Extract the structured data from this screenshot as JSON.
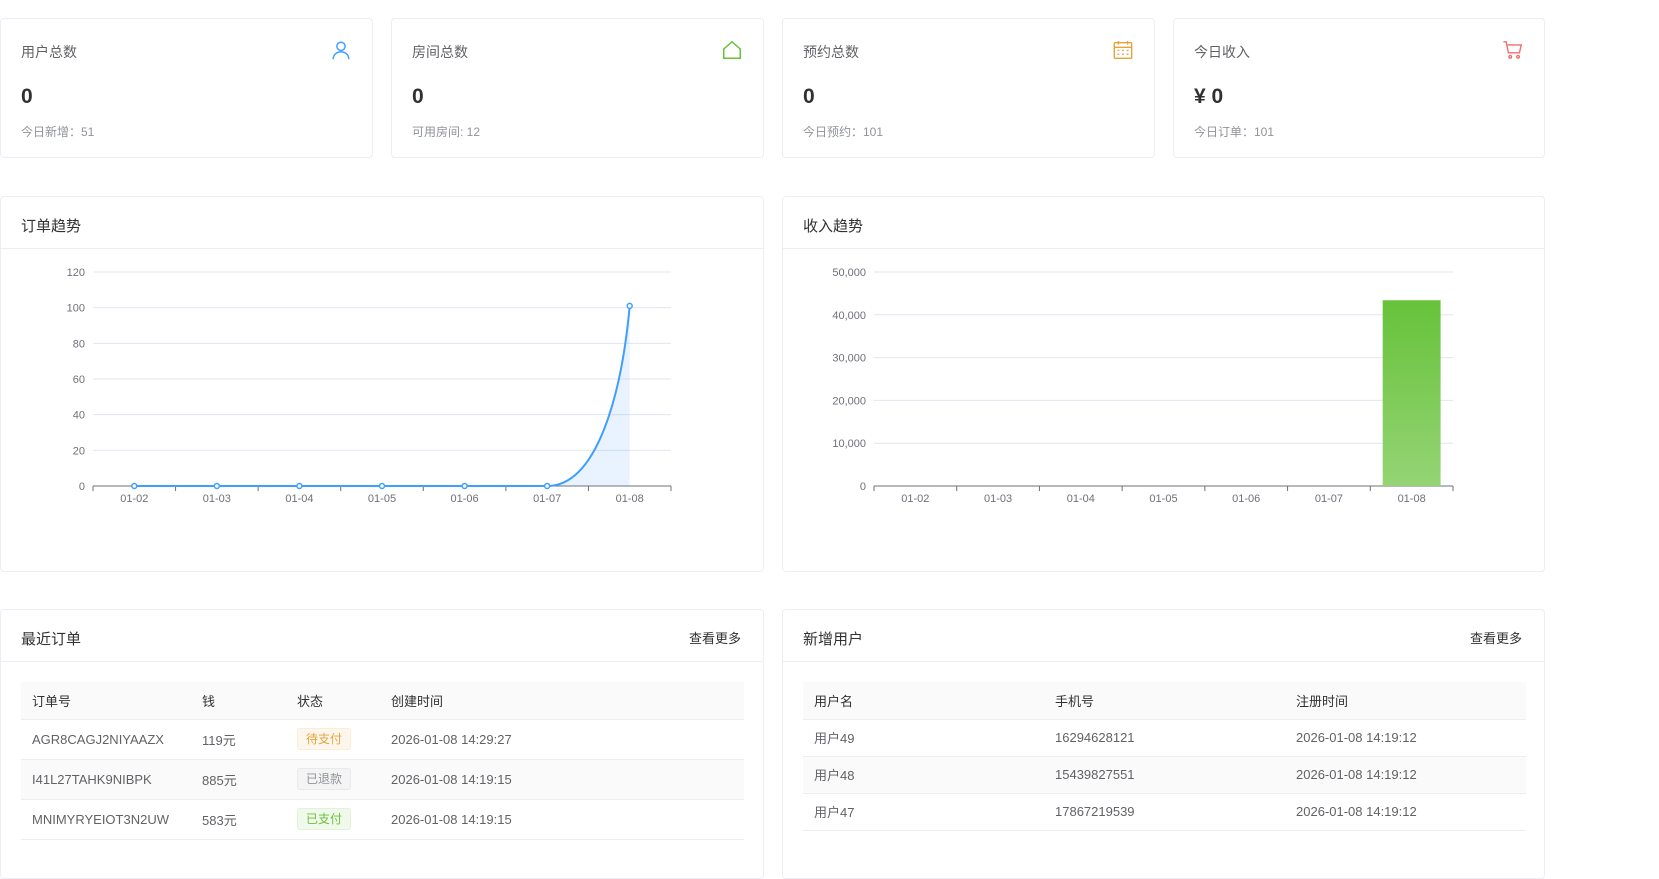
{
  "stats": [
    {
      "title": "用户总数",
      "value": "0",
      "sub": "今日新增：51",
      "icon": "user-icon",
      "color": "#409eff"
    },
    {
      "title": "房间总数",
      "value": "0",
      "sub": "可用房间: 12",
      "icon": "home-icon",
      "color": "#67c23a"
    },
    {
      "title": "预约总数",
      "value": "0",
      "sub": "今日预约：101",
      "icon": "calendar-icon",
      "color": "#e6a23c"
    },
    {
      "title": "今日收入",
      "value": "¥ 0",
      "sub": "今日订单：101",
      "icon": "cart-icon",
      "color": "#f56c6c"
    }
  ],
  "order_trend": {
    "title": "订单趋势"
  },
  "income_trend": {
    "title": "收入趋势"
  },
  "chart_data": [
    {
      "type": "line",
      "title": "订单趋势",
      "categories": [
        "01-02",
        "01-03",
        "01-04",
        "01-05",
        "01-06",
        "01-07",
        "01-08"
      ],
      "values": [
        0,
        0,
        0,
        0,
        0,
        0,
        101
      ],
      "ylim": [
        0,
        120
      ],
      "yticks": [
        0,
        20,
        40,
        60,
        80,
        100,
        120
      ],
      "color": "#409eff",
      "grid": true
    },
    {
      "type": "bar",
      "title": "收入趋势",
      "categories": [
        "01-02",
        "01-03",
        "01-04",
        "01-05",
        "01-06",
        "01-07",
        "01-08"
      ],
      "values": [
        0,
        0,
        0,
        0,
        0,
        0,
        43400
      ],
      "ylim": [
        0,
        50000
      ],
      "yticks": [
        "0",
        "10,000",
        "20,000",
        "30,000",
        "40,000",
        "50,000"
      ],
      "color": "#67c23a",
      "grid": true
    }
  ],
  "recent_orders": {
    "title": "最近订单",
    "more": "查看更多",
    "headers": [
      "订单号",
      "钱",
      "状态",
      "创建时间"
    ],
    "rows": [
      {
        "order_no": "AGR8CAGJ2NIYAAZX",
        "amount": "119元",
        "status": "待支付",
        "status_type": "warning",
        "created": "2026-01-08 14:29:27"
      },
      {
        "order_no": "I41L27TAHK9NIBPK",
        "amount": "885元",
        "status": "已退款",
        "status_type": "info",
        "created": "2026-01-08 14:19:15"
      },
      {
        "order_no": "MNIMYRYEIOT3N2UW",
        "amount": "583元",
        "status": "已支付",
        "status_type": "success",
        "created": "2026-01-08 14:19:15"
      }
    ]
  },
  "new_users": {
    "title": "新增用户",
    "more": "查看更多",
    "headers": [
      "用户名",
      "手机号",
      "注册时间"
    ],
    "rows": [
      {
        "name": "用户49",
        "phone": "16294628121",
        "registered": "2026-01-08 14:19:12"
      },
      {
        "name": "用户48",
        "phone": "15439827551",
        "registered": "2026-01-08 14:19:12"
      },
      {
        "name": "用户47",
        "phone": "17867219539",
        "registered": "2026-01-08 14:19:12"
      }
    ]
  }
}
